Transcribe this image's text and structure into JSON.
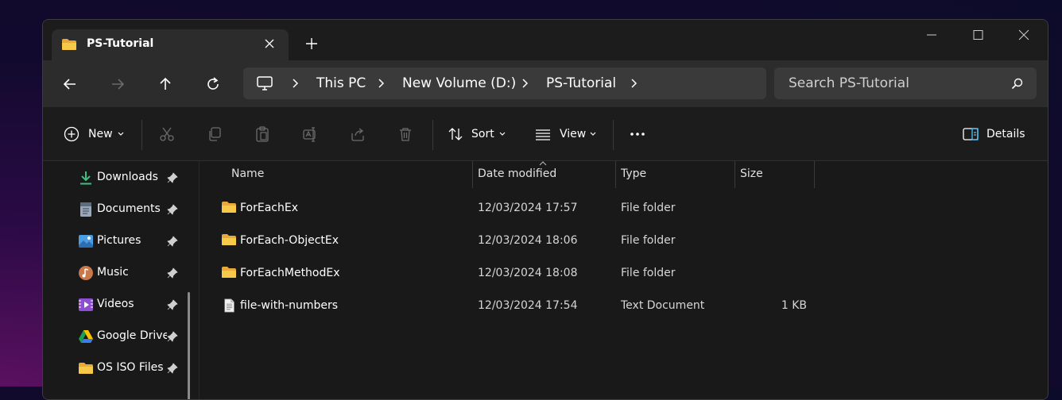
{
  "tab": {
    "title": "PS-Tutorial"
  },
  "breadcrumb": [
    "This PC",
    "New Volume (D:)",
    "PS-Tutorial"
  ],
  "search": {
    "placeholder": "Search PS-Tutorial"
  },
  "toolbar": {
    "new_label": "New",
    "sort_label": "Sort",
    "view_label": "View",
    "details_label": "Details"
  },
  "sidebar": {
    "items": [
      {
        "label": "Downloads",
        "icon": "download-icon"
      },
      {
        "label": "Documents",
        "icon": "documents-icon"
      },
      {
        "label": "Pictures",
        "icon": "pictures-icon"
      },
      {
        "label": "Music",
        "icon": "music-icon"
      },
      {
        "label": "Videos",
        "icon": "videos-icon"
      },
      {
        "label": "Google Drive",
        "icon": "google-drive-icon"
      },
      {
        "label": "OS ISO Files",
        "icon": "folder-icon"
      }
    ]
  },
  "columns": {
    "name": "Name",
    "date": "Date modified",
    "type": "Type",
    "size": "Size"
  },
  "files": [
    {
      "name": "ForEachEx",
      "date": "12/03/2024 17:57",
      "type": "File folder",
      "size": "",
      "icon": "folder-icon"
    },
    {
      "name": "ForEach-ObjectEx",
      "date": "12/03/2024 18:06",
      "type": "File folder",
      "size": "",
      "icon": "folder-icon"
    },
    {
      "name": "ForEachMethodEx",
      "date": "12/03/2024 18:08",
      "type": "File folder",
      "size": "",
      "icon": "folder-icon"
    },
    {
      "name": "file-with-numbers",
      "date": "12/03/2024 17:54",
      "type": "Text Document",
      "size": "1 KB",
      "icon": "text-file-icon"
    }
  ],
  "colors": {
    "folder": "#f5c342",
    "accent": "#4cc2ff"
  }
}
